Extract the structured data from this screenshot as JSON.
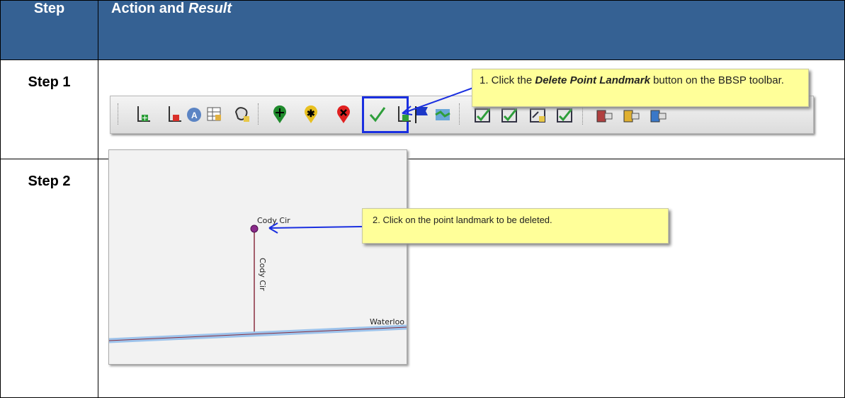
{
  "table": {
    "header_step": "Step",
    "header_action": "Action and ",
    "header_result": "Result",
    "rows": [
      {
        "label": "Step 1"
      },
      {
        "label": "Step 2"
      }
    ]
  },
  "callout1": {
    "prefix": "1. Click the ",
    "bold": "Delete Point Landmark",
    "suffix": " button on the BBSP toolbar."
  },
  "callout2": {
    "text": "2. Click on the point landmark to be deleted."
  },
  "toolbar": {
    "icons": [
      "add-line-icon",
      "delete-line-icon",
      "address-range-icon",
      "table-edit-icon",
      "area-landmark-icon",
      "add-point-landmark-icon",
      "move-point-landmark-icon",
      "delete-point-landmark-icon",
      "verify-icon",
      "line-add-icon",
      "flag-icon",
      "map-icon",
      "check-icon-1",
      "check-icon-2",
      "check-icon-3",
      "check-icon-4",
      "house-icon-1",
      "house-icon-2",
      "house-icon-3"
    ]
  },
  "map": {
    "label_horizontal": "Cody Cir",
    "label_vertical": "Cody Cir",
    "label_waterloo": "Waterloo"
  }
}
